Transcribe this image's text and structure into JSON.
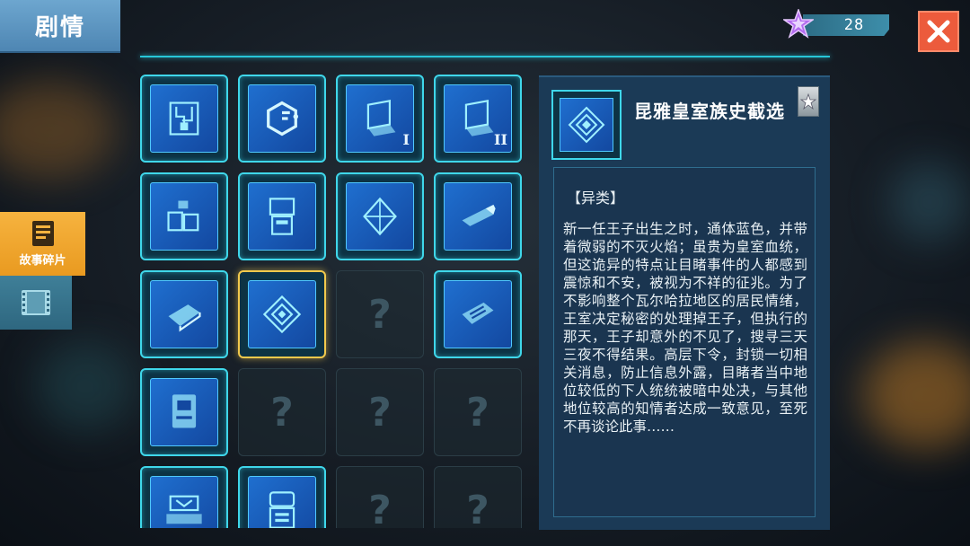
{
  "window": {
    "title": "剧情"
  },
  "currency": {
    "icon": "purple-star-icon",
    "amount": "28"
  },
  "close": {
    "icon": "close-icon"
  },
  "side_tabs": [
    {
      "label": "故事碎片",
      "icon": "document-icon",
      "active": true
    },
    {
      "label": "",
      "icon": "film-icon",
      "active": false
    }
  ],
  "grid": {
    "items": [
      {
        "state": "unlocked",
        "icon": "circuit-map-icon"
      },
      {
        "state": "unlocked",
        "icon": "hexagon-logo-icon"
      },
      {
        "state": "unlocked",
        "icon": "laptop-icon",
        "mark": "I"
      },
      {
        "state": "unlocked",
        "icon": "laptop-icon",
        "mark": "II"
      },
      {
        "state": "unlocked",
        "icon": "device-cluster-icon"
      },
      {
        "state": "unlocked",
        "icon": "terminal-icon"
      },
      {
        "state": "unlocked",
        "icon": "octahedron-crystal-icon"
      },
      {
        "state": "unlocked",
        "icon": "usb-drive-icon"
      },
      {
        "state": "unlocked",
        "icon": "book-icon"
      },
      {
        "state": "selected",
        "icon": "royal-emblem-icon"
      },
      {
        "state": "locked",
        "mark": "?"
      },
      {
        "state": "unlocked",
        "icon": "tablet-device-icon"
      },
      {
        "state": "unlocked",
        "icon": "tablet-book-icon"
      },
      {
        "state": "locked",
        "mark": "?"
      },
      {
        "state": "locked",
        "mark": "?"
      },
      {
        "state": "locked",
        "mark": "?"
      },
      {
        "state": "unlocked",
        "icon": "machine-console-icon"
      },
      {
        "state": "unlocked",
        "icon": "robot-terminal-icon"
      },
      {
        "state": "locked",
        "mark": "?"
      },
      {
        "state": "locked",
        "mark": "?"
      }
    ]
  },
  "detail": {
    "title": "昆雅皇室族史截选",
    "icon": "royal-emblem-icon",
    "rank_icon": "star-badge-icon",
    "category": "【异类】",
    "description": "新一任王子出生之时，通体蓝色，并带着微弱的不灭火焰；虽贵为皇室血统，但这诡异的特点让目睹事件的人都感到震惊和不安，被视为不祥的征兆。为了不影响整个瓦尔哈拉地区的居民情绪，王室决定秘密的处理掉王子，但执行的那天，王子却意外的不见了，搜寻三天三夜不得结果。高层下令，封锁一切相关消息，防止信息外露，目睹者当中地位较低的下人统统被暗中处决，与其他地位较高的知情者达成一致意见，至死不再谈论此事……"
  },
  "colors": {
    "accent_cyan": "#3fd7ea",
    "selected_gold": "#f2c94c",
    "active_tab": "#f6b33f",
    "close_red": "#ec5b3c"
  }
}
